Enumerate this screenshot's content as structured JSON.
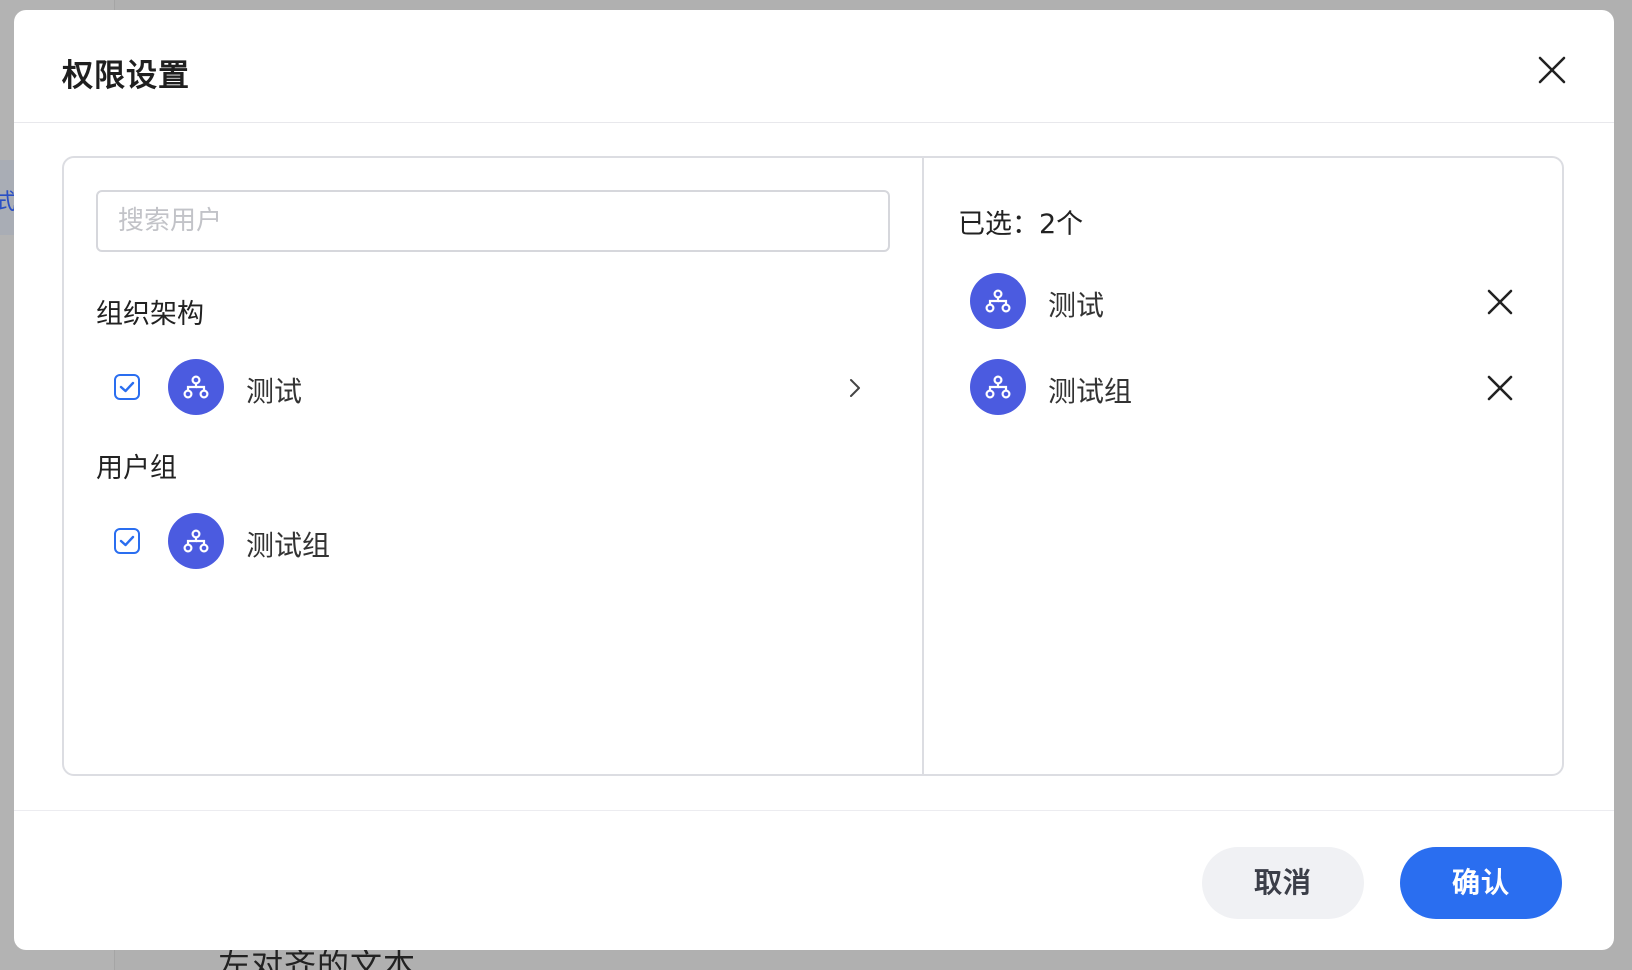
{
  "background": {
    "side_text": "式",
    "bottom_text": "左对齐的文本"
  },
  "dialog": {
    "title": "权限设置",
    "close_icon": "close-icon"
  },
  "search": {
    "placeholder": "搜索用户",
    "value": ""
  },
  "sections": {
    "org": {
      "heading": "组织架构",
      "items": [
        {
          "label": "测试",
          "checked": true,
          "has_children": true
        }
      ]
    },
    "groups": {
      "heading": "用户组",
      "items": [
        {
          "label": "测试组",
          "checked": true,
          "has_children": false
        }
      ]
    }
  },
  "selected": {
    "count_label": "已选：2个",
    "items": [
      {
        "label": "测试"
      },
      {
        "label": "测试组"
      }
    ]
  },
  "footer": {
    "cancel_label": "取消",
    "confirm_label": "确认"
  },
  "colors": {
    "accent": "#2a6ef0",
    "avatar": "#4b5be0",
    "overlay": "#b0b0b0"
  }
}
